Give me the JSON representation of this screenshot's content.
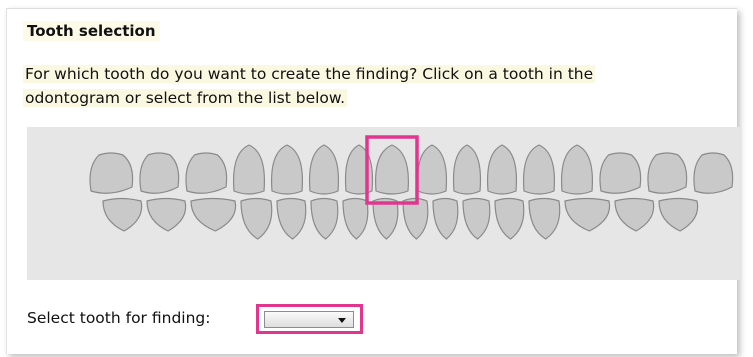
{
  "panel": {
    "title": "Tooth selection",
    "instructions_line1": "For which tooth do you want to create the finding? Click on a tooth in the",
    "instructions_line2": "odontogram or select from the list below."
  },
  "odontogram": {
    "upper_tooth_count": 16,
    "lower_tooth_count": 16,
    "selected_tooth": "upper-8",
    "highlight_color": "#e2358f",
    "tooth_color": "#c9c9c9",
    "background_color": "#e6e6e6"
  },
  "tooth_select": {
    "label": "Select tooth for finding:",
    "value": ""
  }
}
